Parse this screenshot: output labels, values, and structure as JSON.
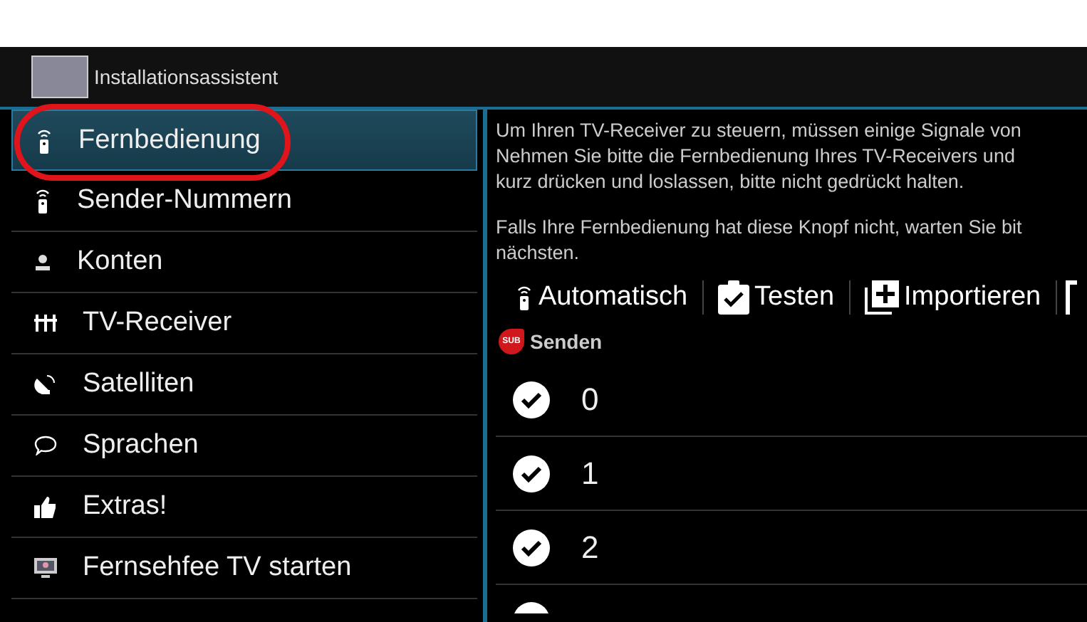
{
  "window": {
    "title": "Installationsassistent"
  },
  "sidebar": {
    "items": [
      {
        "label": "Fernbedienung",
        "kind": "remote",
        "selected": true
      },
      {
        "label": "Sender-Nummern",
        "kind": "remote",
        "selected": false
      },
      {
        "label": "Konten",
        "kind": "person",
        "selected": false
      },
      {
        "label": "TV-Receiver",
        "kind": "sliders",
        "selected": false
      },
      {
        "label": "Satelliten",
        "kind": "dish",
        "selected": false
      },
      {
        "label": "Sprachen",
        "kind": "speech",
        "selected": false
      },
      {
        "label": "Extras!",
        "kind": "thumb",
        "selected": false
      },
      {
        "label": "Fernsehfee TV starten",
        "kind": "tv",
        "selected": false
      }
    ]
  },
  "description": {
    "lines": [
      "Um Ihren TV-Receiver zu steuern, müssen einige Signale von",
      "Nehmen Sie bitte die Fernbedienung Ihres TV-Receivers und",
      "kurz drücken und loslassen, bitte nicht gedrückt halten."
    ],
    "note_lines": [
      "Falls Ihre Fernbedienung hat diese Knopf nicht, warten Sie bit",
      "nächsten."
    ]
  },
  "toolbar": [
    {
      "label": "Automatisch",
      "kind": "remote"
    },
    {
      "label": "Testen",
      "kind": "clipboard"
    },
    {
      "label": "Importieren",
      "kind": "add"
    }
  ],
  "section": {
    "badge": "SUB",
    "title": "Senden"
  },
  "keys": [
    {
      "label": "0",
      "checked": true
    },
    {
      "label": "1",
      "checked": true
    },
    {
      "label": "2",
      "checked": true
    }
  ]
}
